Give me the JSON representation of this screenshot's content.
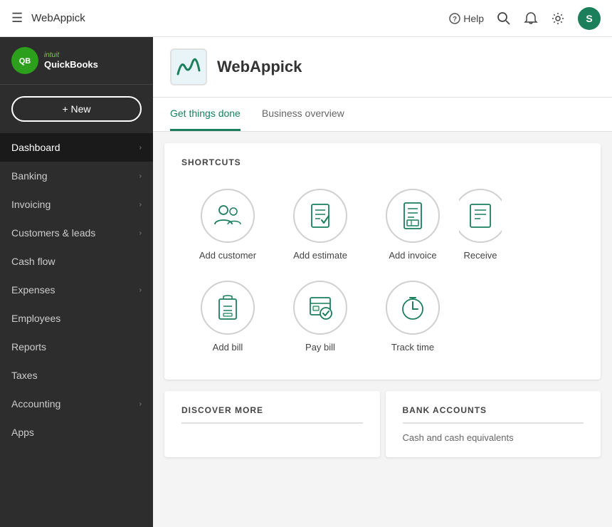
{
  "header": {
    "hamburger_label": "☰",
    "company_name": "WebAppick",
    "help_label": "Help",
    "search_icon": "search",
    "notification_icon": "bell",
    "settings_icon": "gear",
    "avatar_letter": "S"
  },
  "sidebar": {
    "logo": {
      "brand": "intuit",
      "product": "quickbooks"
    },
    "new_button": "+ New",
    "nav_items": [
      {
        "label": "Dashboard",
        "active": true,
        "has_arrow": true
      },
      {
        "label": "Banking",
        "active": false,
        "has_arrow": true
      },
      {
        "label": "Invoicing",
        "active": false,
        "has_arrow": true
      },
      {
        "label": "Customers & leads",
        "active": false,
        "has_arrow": true
      },
      {
        "label": "Cash flow",
        "active": false,
        "has_arrow": false
      },
      {
        "label": "Expenses",
        "active": false,
        "has_arrow": true
      },
      {
        "label": "Employees",
        "active": false,
        "has_arrow": false
      },
      {
        "label": "Reports",
        "active": false,
        "has_arrow": false
      },
      {
        "label": "Taxes",
        "active": false,
        "has_arrow": false
      },
      {
        "label": "Accounting",
        "active": false,
        "has_arrow": true
      },
      {
        "label": "Apps",
        "active": false,
        "has_arrow": false
      }
    ]
  },
  "company": {
    "name": "WebAppick",
    "logo_text": "w"
  },
  "tabs": [
    {
      "label": "Get things done",
      "active": true
    },
    {
      "label": "Business overview",
      "active": false
    }
  ],
  "shortcuts": {
    "title": "SHORTCUTS",
    "items": [
      {
        "label": "Add customer",
        "icon": "customers"
      },
      {
        "label": "Add estimate",
        "icon": "estimate"
      },
      {
        "label": "Add invoice",
        "icon": "invoice"
      },
      {
        "label": "Receive",
        "icon": "receive",
        "partial": true
      },
      {
        "label": "Add bill",
        "icon": "bill"
      },
      {
        "label": "Pay bill",
        "icon": "paybill"
      },
      {
        "label": "Track time",
        "icon": "time"
      }
    ]
  },
  "bottom": {
    "discover_title": "DISCOVER MORE",
    "bank_title": "BANK ACCOUNTS",
    "bank_subtitle": "Cash and cash equivalents"
  }
}
